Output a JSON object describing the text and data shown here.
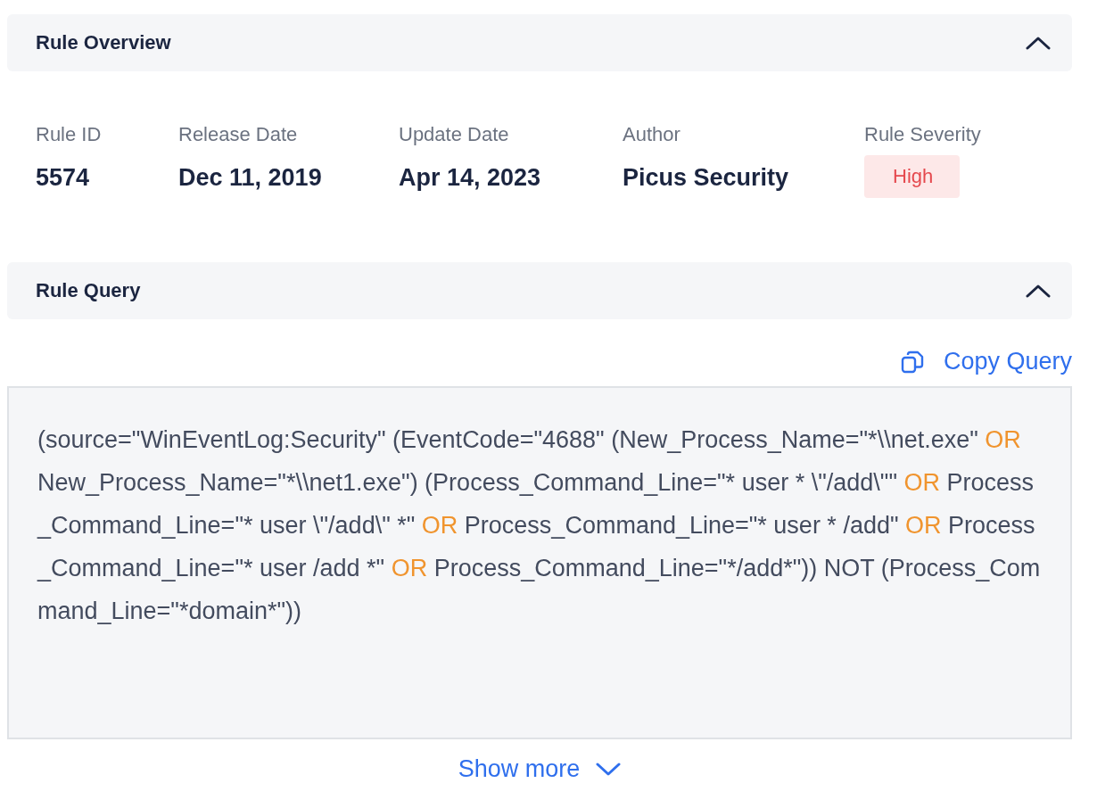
{
  "overview": {
    "title": "Rule Overview",
    "expanded": true,
    "fields": [
      {
        "label": "Rule ID",
        "value": "5574",
        "kind": "text"
      },
      {
        "label": "Release Date",
        "value": "Dec 11, 2019",
        "kind": "text"
      },
      {
        "label": "Update Date",
        "value": "Apr 14, 2023",
        "kind": "text"
      },
      {
        "label": "Author",
        "value": "Picus Security",
        "kind": "text"
      },
      {
        "label": "Rule Severity",
        "value": "High",
        "kind": "severity"
      }
    ]
  },
  "query": {
    "title": "Rule Query",
    "expanded": true,
    "copy_label": "Copy Query",
    "segments": [
      {
        "kind": "text",
        "text": "(source=\"WinEventLog:Security\" (EventCode=\"4688\" (New_Process_Name=\"*\\\\net.exe\" "
      },
      {
        "kind": "keyword",
        "text": "OR"
      },
      {
        "kind": "text",
        "text": " New_Process_Name=\"*\\\\net1.exe\") (Process_Command_Line=\"* user * \\\"/add\\\"\" "
      },
      {
        "kind": "keyword",
        "text": "OR"
      },
      {
        "kind": "text",
        "text": " Process_Command_Line=\"* user \\\"/add\\\" *\" "
      },
      {
        "kind": "keyword",
        "text": "OR"
      },
      {
        "kind": "text",
        "text": " Process_Command_Line=\"* user * /add\" "
      },
      {
        "kind": "keyword",
        "text": "OR"
      },
      {
        "kind": "text",
        "text": " Process_Command_Line=\"* user /add *\" "
      },
      {
        "kind": "keyword",
        "text": "OR"
      },
      {
        "kind": "text",
        "text": " Process_Command_Line=\"*/add*\")) NOT (Process_Command_Line=\"*domain*\"))"
      }
    ],
    "show_more": "Show more"
  }
}
